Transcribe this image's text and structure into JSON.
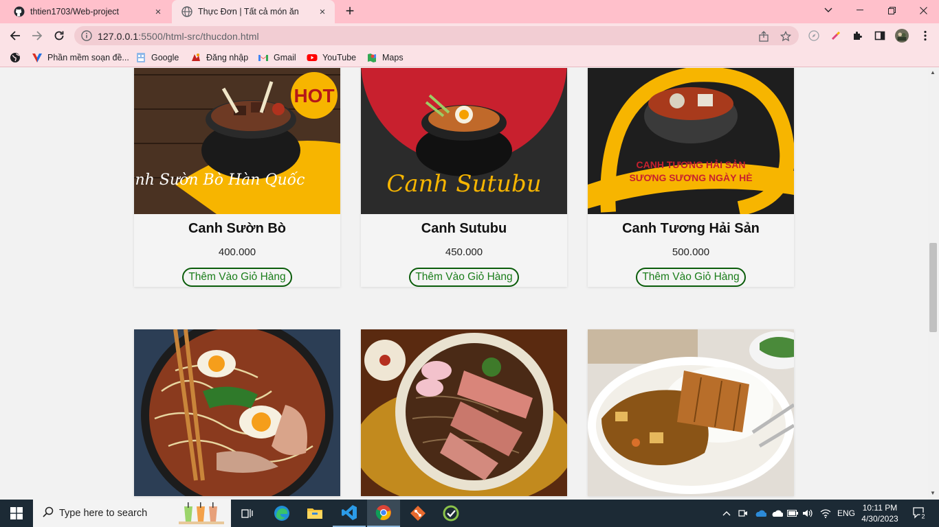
{
  "browser": {
    "tabs": [
      {
        "title": "thtien1703/Web-project",
        "close": "×"
      },
      {
        "title": "Thực Đơn | Tất cả món ăn",
        "close": "×"
      }
    ],
    "new_tab": "+",
    "url_host": "127.0.0.1",
    "url_path": ":5500/html-src/thucdon.html",
    "bookmarks": [
      {
        "label": "Phần mềm soạn đề...",
        "icon": "v-logo-icon"
      },
      {
        "label": "Google",
        "icon": "google-icon"
      },
      {
        "label": "Đăng nhập",
        "icon": "dang-nhap-icon"
      },
      {
        "label": "Gmail",
        "icon": "gmail-icon"
      },
      {
        "label": "YouTube",
        "icon": "youtube-icon"
      },
      {
        "label": "Maps",
        "icon": "maps-icon"
      }
    ]
  },
  "menu": {
    "add_label": "Thêm Vào Giỏ Hàng",
    "items": [
      {
        "name": "Canh Sườn Bò",
        "price": "400.000",
        "badge": "HOT",
        "caption": "Canh Sườn Bò Hàn Quốc"
      },
      {
        "name": "Canh Sutubu",
        "price": "450.000",
        "caption": "Canh Sutubu"
      },
      {
        "name": "Canh Tương Hải Sản",
        "price": "500.000",
        "caption_line1": "CANH TƯƠNG HẢI SẢN",
        "caption_line2": "SƯƠNG SƯƠNG NGÀY HÈ"
      },
      {
        "name": "",
        "price": ""
      },
      {
        "name": "",
        "price": ""
      },
      {
        "name": "",
        "price": ""
      }
    ]
  },
  "taskbar": {
    "search_placeholder": "Type here to search",
    "lang": "ENG",
    "time": "10:11 PM",
    "date": "4/30/2023",
    "notifications": "2"
  },
  "colors": {
    "chrome_pink": "#ffc0cb",
    "toolbar_pink": "#fbe2e6",
    "button_green": "#1a7d1a",
    "taskbar": "#1c2a35"
  }
}
